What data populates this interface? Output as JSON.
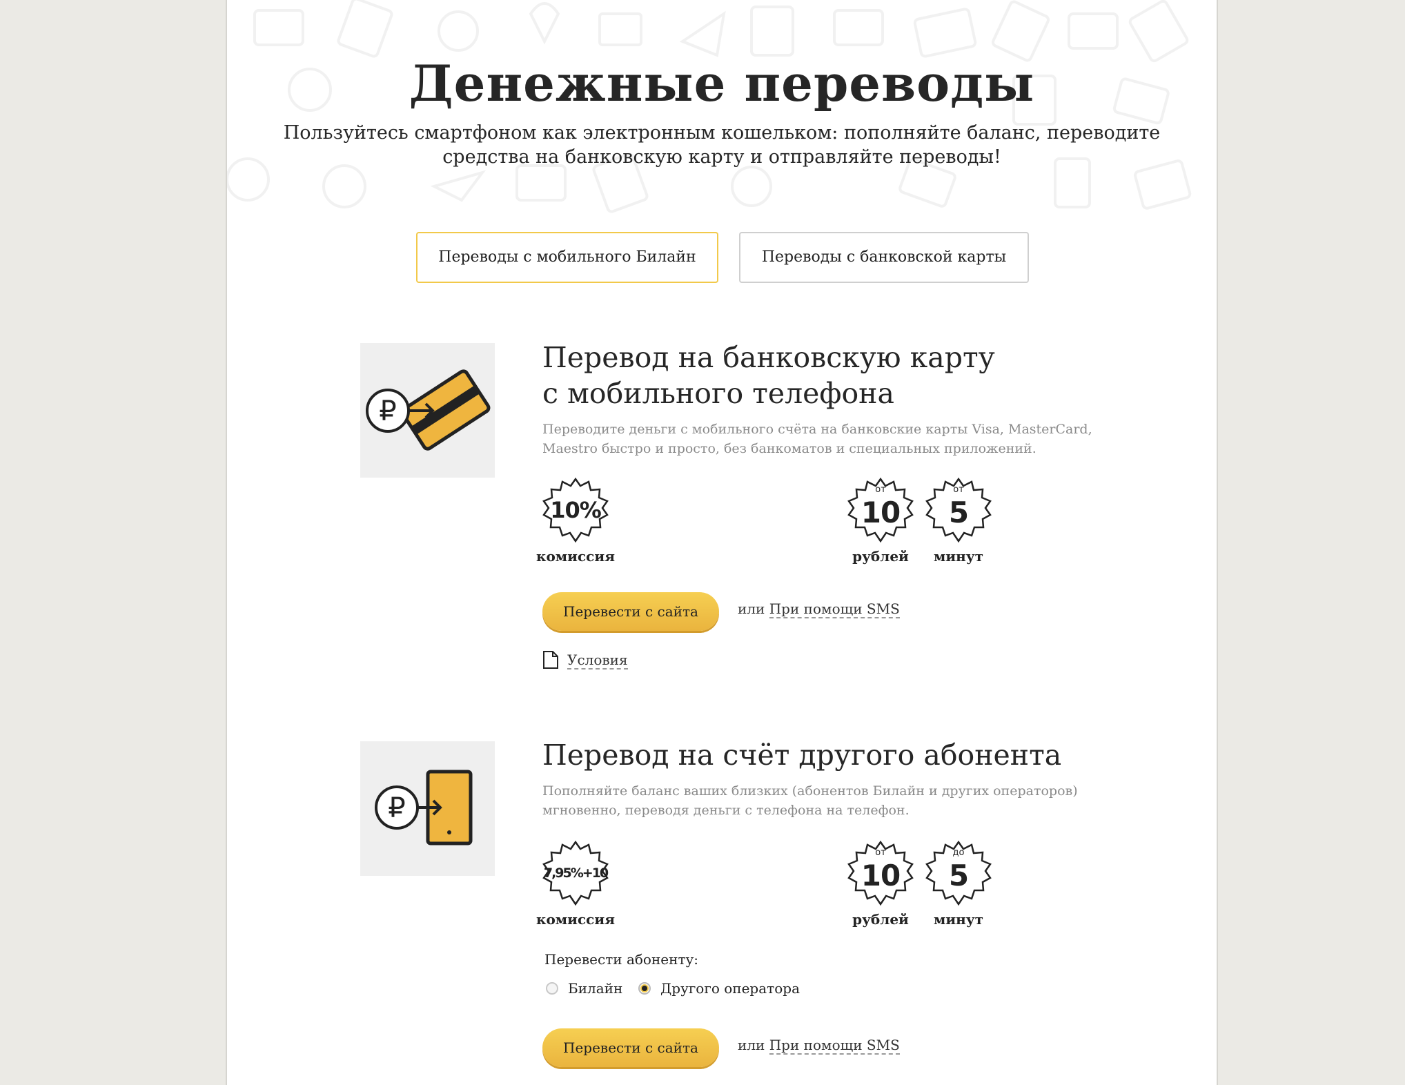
{
  "hero": {
    "title": "Денежные переводы",
    "subtitle": "Пользуйтесь смартфоном как электронным кошельком: пополняйте баланс, переводите средства на банковскую карту и отправляйте переводы!"
  },
  "tabs": [
    {
      "label": "Переводы с мобильного Билайн",
      "active": true
    },
    {
      "label": "Переводы с банковской карты",
      "active": false
    }
  ],
  "sections": [
    {
      "title_line1": "Перевод на банковскую карту",
      "title_line2": "с мобильного телефона",
      "description": "Переводите деньги с мобильного счёта на банковские карты Visa, MasterCard, Maestro быстро и просто, без банкоматов и специальных приложений.",
      "badges": [
        {
          "prefix": "",
          "value": "10%",
          "label": "комиссия"
        },
        {
          "prefix": "от",
          "value": "10",
          "label": "рублей"
        },
        {
          "prefix": "от",
          "value": "5",
          "label": "минут"
        }
      ],
      "button": "Перевести с сайта",
      "or": "или",
      "sms_link": "При помощи SMS",
      "conditions": "Условия"
    },
    {
      "title": "Перевод на счёт другого абонента",
      "description": "Пополняйте баланс ваших близких (абонентов Билайн и других операторов) мгновенно, переводя деньги с телефона на телефон.",
      "badges": [
        {
          "prefix": "",
          "value": "7,95%+10",
          "label": "комиссия"
        },
        {
          "prefix": "от",
          "value": "10",
          "label": "рублей"
        },
        {
          "prefix": "до",
          "value": "5",
          "label": "минут"
        }
      ],
      "radio_title": "Перевести абоненту:",
      "radios": [
        {
          "label": "Билайн",
          "checked": false
        },
        {
          "label": "Другого оператора",
          "checked": true
        }
      ],
      "button": "Перевести с сайта",
      "or": "или",
      "sms_link": "При помощи SMS"
    }
  ],
  "colors": {
    "accent": "#f2c94a",
    "button": "#efbe45",
    "background": "#ebeae5",
    "muted_text": "#8a8a8a"
  }
}
